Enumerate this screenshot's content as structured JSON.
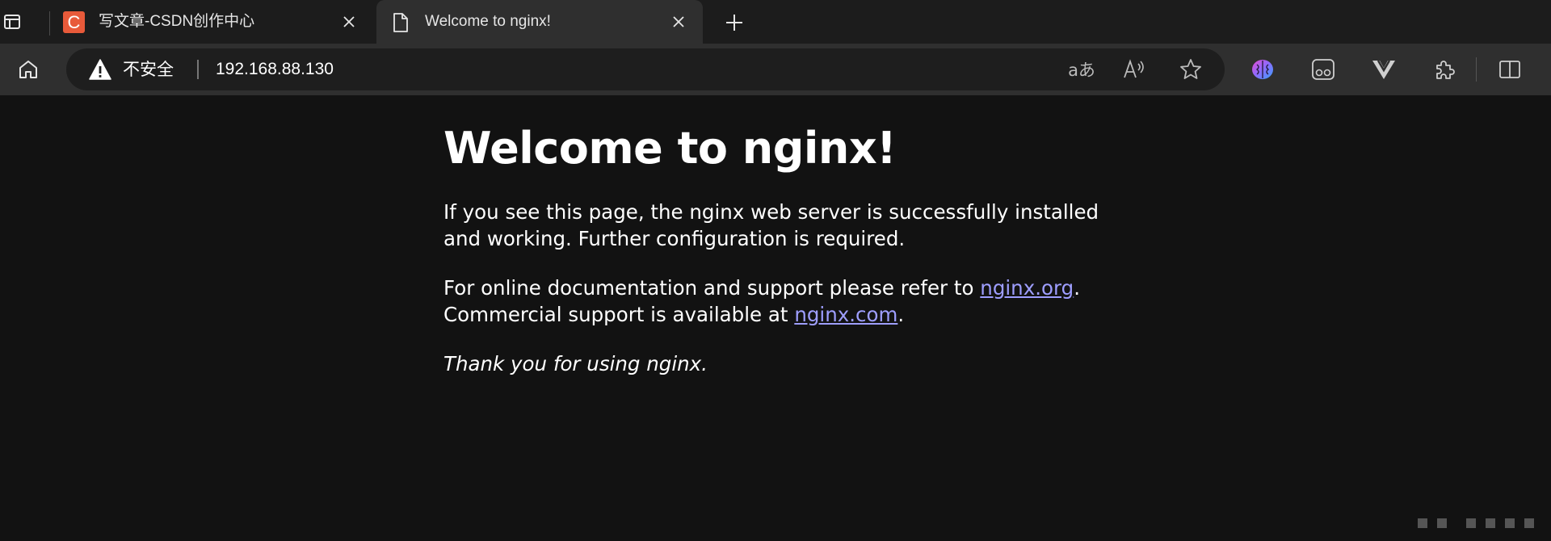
{
  "tabs": [
    {
      "title": "写文章-CSDN创作中心",
      "favicon_letter": "C",
      "favicon_color": "#e85a3a",
      "active": false
    },
    {
      "title": "Welcome to nginx!",
      "favicon": "page-icon",
      "active": true
    }
  ],
  "toolbar": {
    "security_label": "不安全",
    "url": "192.168.88.130",
    "translate_icon_text": "aあ"
  },
  "page": {
    "heading": "Welcome to nginx!",
    "para1": "If you see this page, the nginx web server is successfully installed and working. Further configuration is required.",
    "para2_prefix": "For online documentation and support please refer to ",
    "para2_link1": "nginx.org",
    "para2_mid": ".",
    "para2_line2_prefix": "Commercial support is available at ",
    "para2_link2": "nginx.com",
    "para2_end": ".",
    "thanks": "Thank you for using nginx."
  },
  "colors": {
    "background": "#121212",
    "link": "#9e9eff",
    "tab_active": "#2f2f2f",
    "tabstrip": "#1c1c1c"
  }
}
